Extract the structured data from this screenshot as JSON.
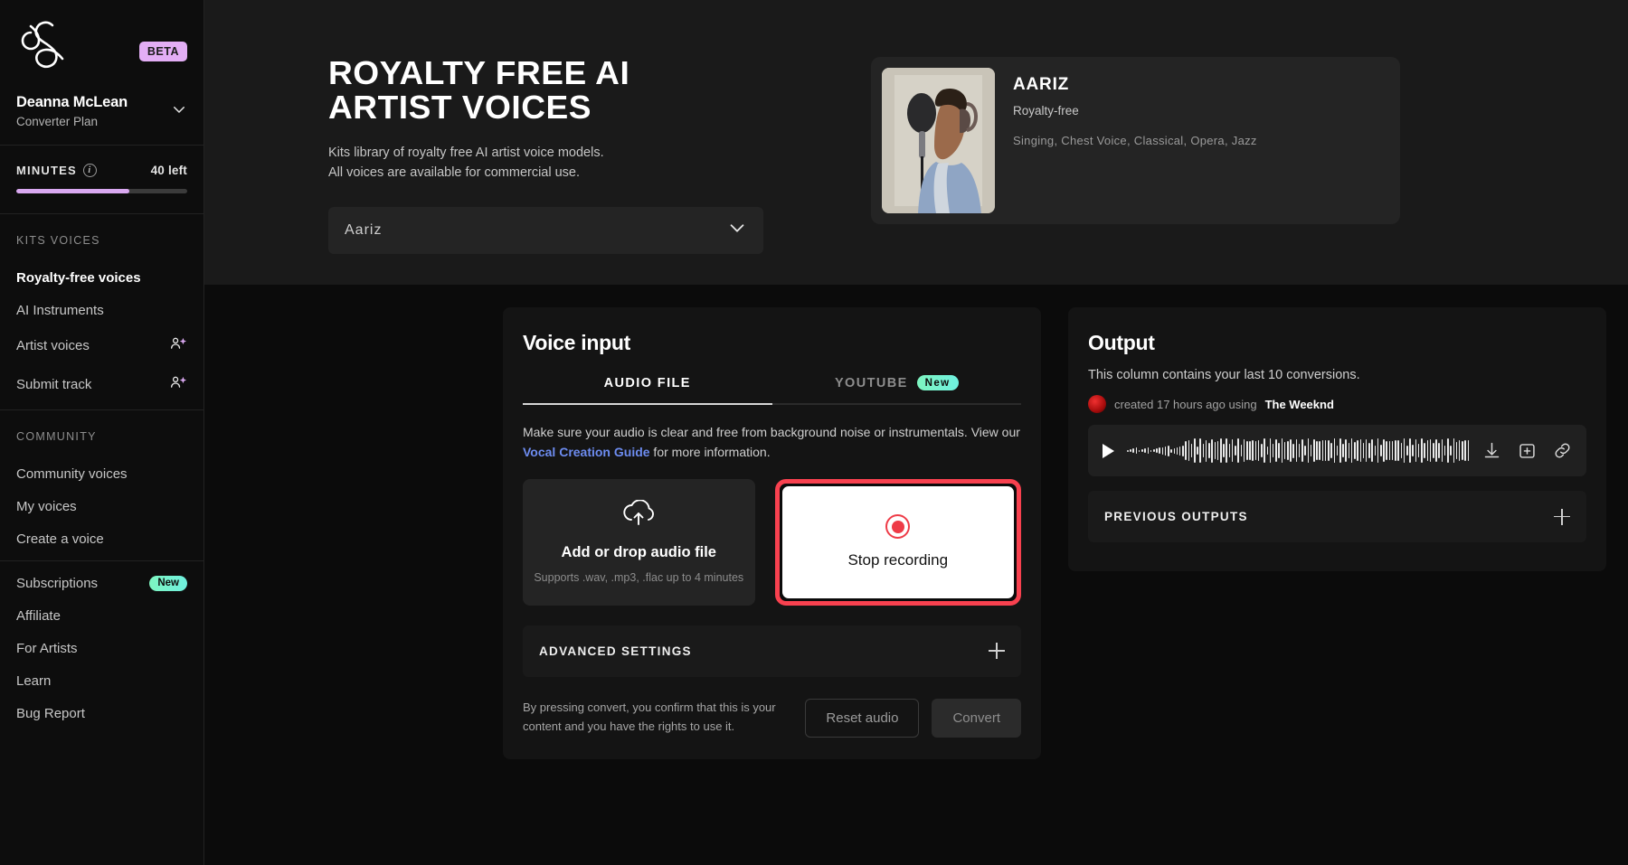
{
  "sidebar": {
    "brand_icon": "kits-ampersand-logo",
    "beta_badge": "BETA",
    "account": {
      "name": "Deanna McLean",
      "plan": "Converter Plan"
    },
    "minutes": {
      "label": "MINUTES",
      "remaining": "40 left",
      "progress_percent": 66
    },
    "sections": [
      {
        "heading": "KITS VOICES",
        "items": [
          {
            "label": "Royalty-free voices",
            "active": true,
            "badge": null,
            "icon": null
          },
          {
            "label": "AI Instruments",
            "active": false,
            "badge": null,
            "icon": null
          },
          {
            "label": "Artist voices",
            "active": false,
            "badge": null,
            "icon": "user-sparkle-icon"
          },
          {
            "label": "Submit track",
            "active": false,
            "badge": null,
            "icon": "user-sparkle-icon"
          }
        ]
      },
      {
        "heading": "COMMUNITY",
        "items": [
          {
            "label": "Community voices",
            "active": false,
            "badge": null,
            "icon": null
          },
          {
            "label": "My voices",
            "active": false,
            "badge": null,
            "icon": null
          },
          {
            "label": "Create a voice",
            "active": false,
            "badge": null,
            "icon": null
          }
        ]
      },
      {
        "heading": null,
        "items": [
          {
            "label": "Subscriptions",
            "active": false,
            "badge": "New",
            "icon": null
          },
          {
            "label": "Affiliate",
            "active": false,
            "badge": null,
            "icon": null
          },
          {
            "label": "For Artists",
            "active": false,
            "badge": null,
            "icon": null
          },
          {
            "label": "Learn",
            "active": false,
            "badge": null,
            "icon": null
          },
          {
            "label": "Bug Report",
            "active": false,
            "badge": null,
            "icon": null
          }
        ]
      }
    ]
  },
  "hero": {
    "title": "ROYALTY FREE AI ARTIST VOICES",
    "subtitle_line1": "Kits library of royalty free AI artist voice models.",
    "subtitle_line2": "All voices are available for commercial use.",
    "voice_select": {
      "value": "Aariz",
      "chevron": "chevron-down-icon"
    },
    "card": {
      "name": "AARIZ",
      "tag": "Royalty-free",
      "styles": "Singing, Chest Voice, Classical, Opera, Jazz",
      "avatar_alt": "singer-at-microphone-portrait"
    }
  },
  "voice_input": {
    "title": "Voice input",
    "tabs": [
      {
        "label": "AUDIO FILE",
        "active": true,
        "badge": null
      },
      {
        "label": "YOUTUBE",
        "active": false,
        "badge": "New"
      }
    ],
    "hint_before_link": "Make sure your audio is clear and free from background noise or instrumentals. View our ",
    "hint_link": "Vocal Creation Guide",
    "hint_after_link": " for more information.",
    "dropzone": {
      "icon": "cloud-upload-icon",
      "title": "Add or drop audio file",
      "subtitle": "Supports .wav, .mp3, .flac up to 4 minutes"
    },
    "record_button": {
      "label": "Stop recording",
      "icon": "record-dot-icon",
      "highlight_color": "#f8414f"
    },
    "advanced_settings": {
      "label": "ADVANCED SETTINGS",
      "expand_icon": "plus-icon"
    },
    "disclaimer": "By pressing convert, you confirm that this is your content and you have the rights to use it.",
    "reset_label": "Reset audio",
    "convert_label": "Convert"
  },
  "output": {
    "title": "Output",
    "subtitle": "This column contains your last 10 conversions.",
    "item": {
      "avatar": "artist-avatar",
      "meta_prefix": "created 17 hours ago using ",
      "meta_artist": "The Weeknd"
    },
    "player": {
      "play_icon": "play-icon",
      "waveform": "audio-waveform",
      "download_icon": "download-icon",
      "save_icon": "save-to-library-icon",
      "link_icon": "copy-link-icon"
    },
    "previous_outputs": {
      "label": "PREVIOUS OUTPUTS",
      "expand_icon": "plus-icon"
    }
  },
  "colors": {
    "accent_purple": "#d9a8f0",
    "accent_green": "#7ef5c0",
    "record_red": "#f8414f",
    "link_blue": "#6d8cf0"
  }
}
